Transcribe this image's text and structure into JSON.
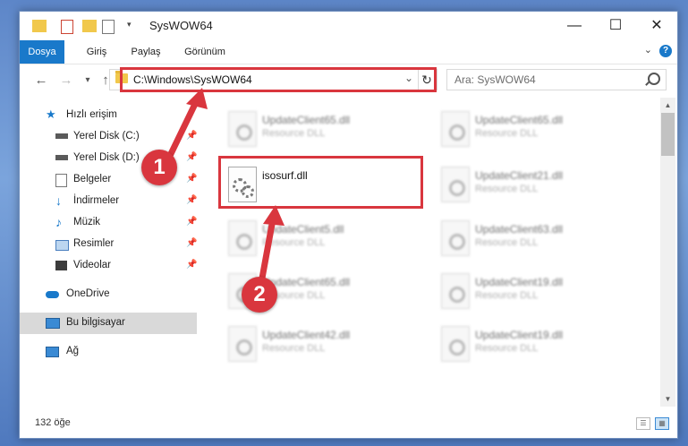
{
  "window": {
    "title": "SysWOW64",
    "controls": {
      "minimize": "—",
      "maximize": "☐",
      "close": "✕"
    }
  },
  "ribbon": {
    "tabs": [
      "Dosya",
      "Giriş",
      "Paylaş",
      "Görünüm"
    ],
    "help": "?"
  },
  "navigation": {
    "address": "C:\\Windows\\SysWOW64",
    "search_placeholder": "Ara: SysWOW64"
  },
  "sidebar": {
    "items": [
      {
        "label": "Hızlı erişim",
        "icon": "star-icon"
      },
      {
        "label": "Yerel Disk (C:)",
        "icon": "drive-icon",
        "pinned": true
      },
      {
        "label": "Yerel Disk (D:)",
        "icon": "drive-icon",
        "pinned": true
      },
      {
        "label": "Belgeler",
        "icon": "documents-icon",
        "pinned": true
      },
      {
        "label": "İndirmeler",
        "icon": "download-icon",
        "pinned": true
      },
      {
        "label": "Müzik",
        "icon": "music-icon",
        "pinned": true
      },
      {
        "label": "Resimler",
        "icon": "pictures-icon",
        "pinned": true
      },
      {
        "label": "Videolar",
        "icon": "videos-icon",
        "pinned": true
      },
      {
        "label": "OneDrive",
        "icon": "cloud-icon"
      },
      {
        "label": "Bu bilgisayar",
        "icon": "computer-icon",
        "selected": true
      },
      {
        "label": "Ağ",
        "icon": "network-icon"
      }
    ]
  },
  "files": {
    "left": [
      {
        "name": "UpdateClient65.dll",
        "desc": "Resource DLL"
      },
      {
        "name": "isosurf.dll",
        "desc": ""
      },
      {
        "name": "UpdateClient5.dll",
        "desc": "Resource DLL"
      },
      {
        "name": "UpdateClient65.dll",
        "desc": "Resource DLL"
      },
      {
        "name": "UpdateClient42.dll",
        "desc": "Resource DLL"
      }
    ],
    "right": [
      {
        "name": "UpdateClient65.dll",
        "desc": "Resource DLL"
      },
      {
        "name": "UpdateClient21.dll",
        "desc": "Resource DLL"
      },
      {
        "name": "UpdateClient63.dll",
        "desc": "Resource DLL"
      },
      {
        "name": "UpdateClient19.dll",
        "desc": "Resource DLL"
      },
      {
        "name": "UpdateClient19.dll",
        "desc": "Resource DLL"
      }
    ]
  },
  "status": {
    "count": "132 öğe"
  },
  "annotations": {
    "badge1": "1",
    "badge2": "2",
    "color": "#d9363e"
  }
}
